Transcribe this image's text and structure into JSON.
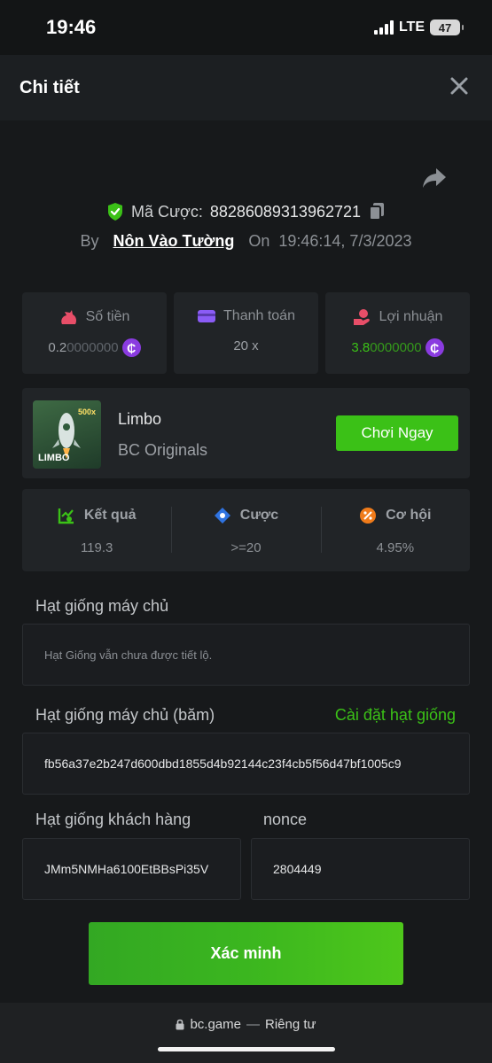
{
  "status": {
    "time": "19:46",
    "network": "LTE",
    "battery": "47"
  },
  "header": {
    "title": "Chi tiết"
  },
  "bet": {
    "id_label": "Mã Cược:",
    "id_value": "88286089313962721",
    "by_label": "By",
    "user": "Nôn Vào Tường",
    "on_label": "On",
    "datetime": "19:46:14, 7/3/2023"
  },
  "stats": {
    "amount": {
      "label": "Số tiền",
      "value_main": "0.2",
      "value_rest": "0000000"
    },
    "payout": {
      "label": "Thanh toán",
      "value": "20 x"
    },
    "profit": {
      "label": "Lợi nhuận",
      "value_main": "3.8",
      "value_rest": "0000000"
    }
  },
  "coin_symbol": "₵",
  "game": {
    "name": "Limbo",
    "provider": "BC Originals",
    "thumb_title": "LIMBO",
    "thumb_badge": "500x",
    "play_label": "Chơi Ngay"
  },
  "result_stats": {
    "result": {
      "label": "Kết quả",
      "value": "119.3"
    },
    "bet": {
      "label": "Cược",
      "value": ">=20"
    },
    "chance": {
      "label": "Cơ hội",
      "value": "4.95%"
    }
  },
  "seeds": {
    "server_label": "Hạt giống máy chủ",
    "server_value": "Hạt Giống vẫn chưa được tiết lộ.",
    "server_hash_label": "Hạt giống máy chủ (băm)",
    "settings_link": "Cài đặt hạt giống",
    "server_hash_value": "fb56a37e2b247d600dbd1855d4b92144c23f4cb5f56d47bf1005c9",
    "client_label": "Hạt giống khách hàng",
    "client_value": "JMm5NMHa6100EtBBsPi35V",
    "nonce_label": "nonce",
    "nonce_value": "2804449"
  },
  "verify_label": "Xác minh",
  "browser": {
    "domain": "bc.game",
    "separator": "—",
    "mode": "Riêng tư"
  },
  "colors": {
    "accent_green": "#3bc117",
    "coin_purple": "#8a3be0",
    "panel": "#212427"
  }
}
